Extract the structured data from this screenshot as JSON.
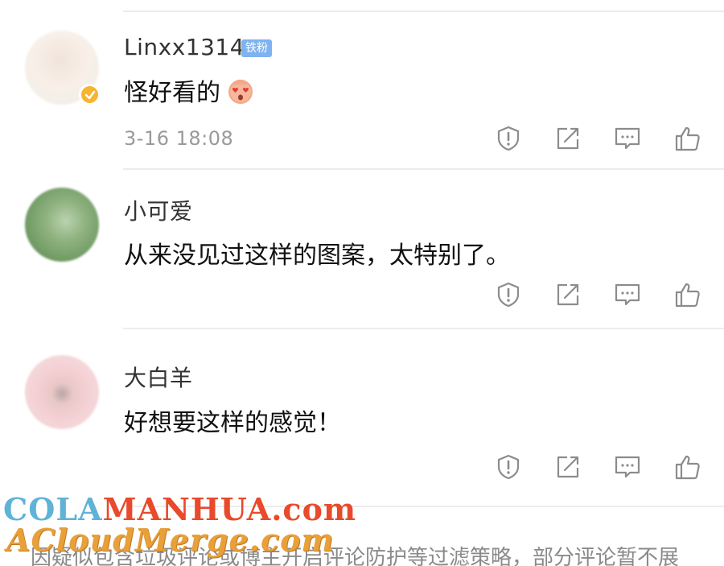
{
  "comments": [
    {
      "username": "Linxx1314",
      "badge": "铁粉",
      "text": "怪好看的",
      "emoji": "heart-eyes-emoji",
      "timestamp": "3-16 18:08",
      "verified": true
    },
    {
      "username": "小可爱",
      "text": "从来没见过这样的图案，太特别了。"
    },
    {
      "username": "大白羊",
      "text": "好想要这样的感觉！"
    }
  ],
  "actions": [
    "report-icon",
    "share-icon",
    "comment-icon",
    "like-icon"
  ],
  "watermark": {
    "line1_a": "COLA",
    "line1_b": "MANHUA",
    "line1_c": ".com",
    "line2": "ACloudMerge.com"
  },
  "footer_note": "因疑似包含垃圾评论或博主开启评论防护等过滤策略，部分评论暂不展",
  "colors": {
    "badge_blue": "#7fb3f0",
    "verified_gold": "#f5b432",
    "icon_gray": "#8c8c8c"
  }
}
